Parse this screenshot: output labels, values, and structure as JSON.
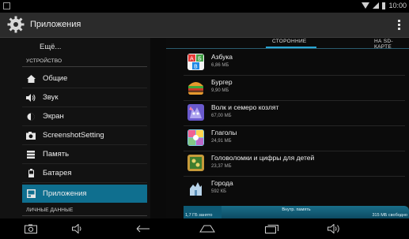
{
  "status_bar": {
    "time": "10:00"
  },
  "action_bar": {
    "title": "Приложения"
  },
  "left_panel": {
    "more_label": "Ещё...",
    "section_device": "УСТРОЙСТВО",
    "items": [
      {
        "label": "Общие",
        "icon": "home-icon"
      },
      {
        "label": "Звук",
        "icon": "speaker-icon"
      },
      {
        "label": "Экран",
        "icon": "brightness-icon"
      },
      {
        "label": "ScreenshotSetting",
        "icon": "camera-icon"
      },
      {
        "label": "Память",
        "icon": "storage-icon"
      },
      {
        "label": "Батарея",
        "icon": "battery-icon"
      },
      {
        "label": "Приложения",
        "icon": "apps-icon",
        "active": true
      }
    ],
    "section_personal": "ЛИЧНЫЕ ДАННЫЕ"
  },
  "tabs": {
    "third_party": "СТОРОННИЕ",
    "sd_card": "НА SD-КАРТЕ"
  },
  "apps": [
    {
      "name": "Азбука",
      "size": "6,86 МБ",
      "icon": "azbuka-app-icon"
    },
    {
      "name": "Бургер",
      "size": "9,90 МБ",
      "icon": "burger-app-icon"
    },
    {
      "name": "Волк и семеро козлят",
      "size": "67,00 МБ",
      "icon": "wolf-app-icon"
    },
    {
      "name": "Глаголы",
      "size": "24,91 МБ",
      "icon": "verbs-app-icon"
    },
    {
      "name": "Головоломки и цифры для детей",
      "size": "23,37 МБ",
      "icon": "puzzles-app-icon"
    },
    {
      "name": "Города",
      "size": "592 КБ",
      "icon": "cities-app-icon"
    }
  ],
  "storage": {
    "label": "Внутр. память",
    "used": "1,7 ГБ занято",
    "free": "315 МБ свободно"
  }
}
